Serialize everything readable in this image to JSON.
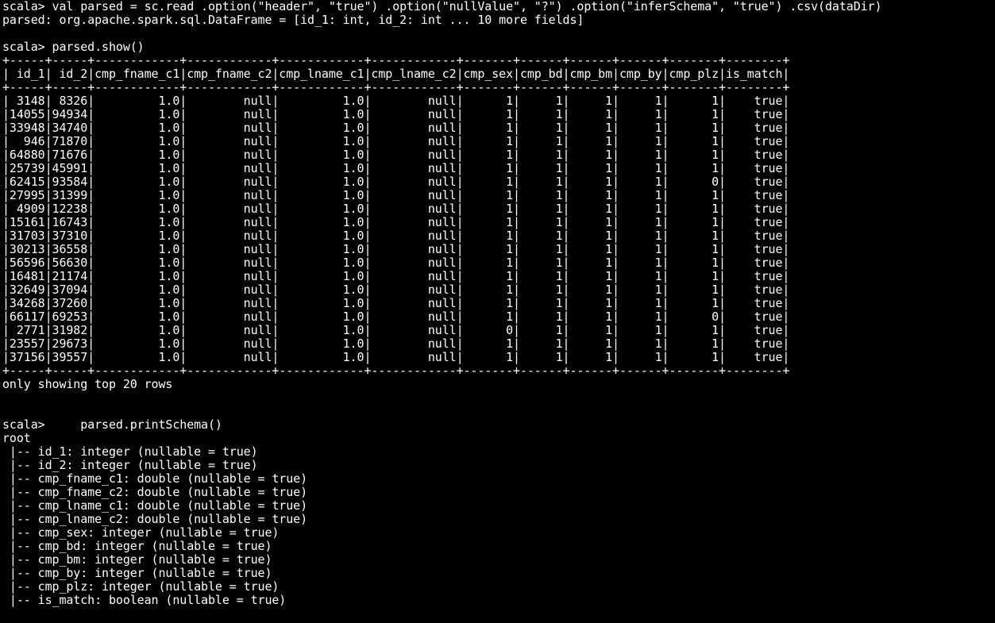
{
  "terminal": {
    "lines": [
      "scala> val parsed = sc.read .option(\"header\", \"true\") .option(\"nullValue\", \"?\") .option(\"inferSchema\", \"true\") .csv(dataDir)",
      "parsed: org.apache.spark.sql.DataFrame = [id_1: int, id_2: int ... 10 more fields]",
      "",
      "scala> parsed.show()",
      "+-----+-----+------------+------------+------------+------------+-------+------+------+------+-------+--------+",
      "| id_1| id_2|cmp_fname_c1|cmp_fname_c2|cmp_lname_c1|cmp_lname_c2|cmp_sex|cmp_bd|cmp_bm|cmp_by|cmp_plz|is_match|",
      "+-----+-----+------------+------------+------------+------------+-------+------+------+------+-------+--------+",
      "| 3148| 8326|         1.0|        null|         1.0|        null|      1|     1|     1|     1|      1|    true|",
      "|14055|94934|         1.0|        null|         1.0|        null|      1|     1|     1|     1|      1|    true|",
      "|33948|34740|         1.0|        null|         1.0|        null|      1|     1|     1|     1|      1|    true|",
      "|  946|71870|         1.0|        null|         1.0|        null|      1|     1|     1|     1|      1|    true|",
      "|64880|71676|         1.0|        null|         1.0|        null|      1|     1|     1|     1|      1|    true|",
      "|25739|45991|         1.0|        null|         1.0|        null|      1|     1|     1|     1|      1|    true|",
      "|62415|93584|         1.0|        null|         1.0|        null|      1|     1|     1|     1|      0|    true|",
      "|27995|31399|         1.0|        null|         1.0|        null|      1|     1|     1|     1|      1|    true|",
      "| 4909|12238|         1.0|        null|         1.0|        null|      1|     1|     1|     1|      1|    true|",
      "|15161|16743|         1.0|        null|         1.0|        null|      1|     1|     1|     1|      1|    true|",
      "|31703|37310|         1.0|        null|         1.0|        null|      1|     1|     1|     1|      1|    true|",
      "|30213|36558|         1.0|        null|         1.0|        null|      1|     1|     1|     1|      1|    true|",
      "|56596|56630|         1.0|        null|         1.0|        null|      1|     1|     1|     1|      1|    true|",
      "|16481|21174|         1.0|        null|         1.0|        null|      1|     1|     1|     1|      1|    true|",
      "|32649|37094|         1.0|        null|         1.0|        null|      1|     1|     1|     1|      1|    true|",
      "|34268|37260|         1.0|        null|         1.0|        null|      1|     1|     1|     1|      1|    true|",
      "|66117|69253|         1.0|        null|         1.0|        null|      1|     1|     1|     1|      0|    true|",
      "| 2771|31982|         1.0|        null|         1.0|        null|      0|     1|     1|     1|      1|    true|",
      "|23557|29673|         1.0|        null|         1.0|        null|      1|     1|     1|     1|      1|    true|",
      "|37156|39557|         1.0|        null|         1.0|        null|      1|     1|     1|     1|      1|    true|",
      "+-----+-----+------------+------------+------------+------------+-------+------+------+------+-------+--------+",
      "only showing top 20 rows",
      "",
      "",
      "scala>     parsed.printSchema()",
      "root",
      " |-- id_1: integer (nullable = true)",
      " |-- id_2: integer (nullable = true)",
      " |-- cmp_fname_c1: double (nullable = true)",
      " |-- cmp_fname_c2: double (nullable = true)",
      " |-- cmp_lname_c1: double (nullable = true)",
      " |-- cmp_lname_c2: double (nullable = true)",
      " |-- cmp_sex: integer (nullable = true)",
      " |-- cmp_bd: integer (nullable = true)",
      " |-- cmp_bm: integer (nullable = true)",
      " |-- cmp_by: integer (nullable = true)",
      " |-- cmp_plz: integer (nullable = true)",
      " |-- is_match: boolean (nullable = true)"
    ]
  },
  "colors": {
    "background": "#000000",
    "text": "#ffffff"
  }
}
